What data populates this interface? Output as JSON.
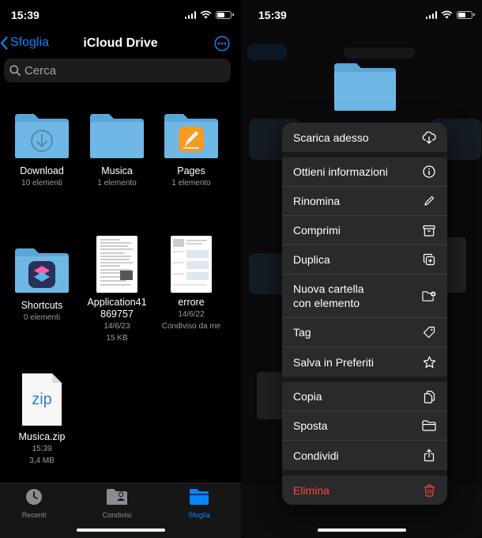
{
  "status": {
    "time": "15:39"
  },
  "nav": {
    "back_label": "Sfoglia",
    "title": "iCloud Drive"
  },
  "search": {
    "placeholder": "Cerca"
  },
  "files": [
    {
      "name": "Download",
      "meta1": "10 elementi",
      "meta2": ""
    },
    {
      "name": "Musica",
      "meta1": "1 elemento",
      "meta2": ""
    },
    {
      "name": "Pages",
      "meta1": "1 elemento",
      "meta2": ""
    },
    {
      "name": "Shortcuts",
      "meta1": "0 elementi",
      "meta2": ""
    },
    {
      "name": "Application41\n869757",
      "meta1": "14/6/23",
      "meta2": "15 KB"
    },
    {
      "name": "errore",
      "meta1": "14/6/22",
      "meta2": "Condiviso da me"
    },
    {
      "name": "Musica.zip",
      "meta1": "15:39",
      "meta2": "3,4 MB",
      "badge": "zip"
    }
  ],
  "tabs": [
    {
      "label": "Recenti",
      "icon": "clock-icon"
    },
    {
      "label": "Condivisi",
      "icon": "shared-folder-icon"
    },
    {
      "label": "Sfoglia",
      "icon": "browse-folder-icon",
      "active": true
    }
  ],
  "context_menu": {
    "items": [
      {
        "label": "Scarica adesso",
        "icon": "cloud-download-icon"
      },
      {
        "label": "Ottieni informazioni",
        "icon": "info-icon"
      },
      {
        "label": "Rinomina",
        "icon": "pencil-icon"
      },
      {
        "label": "Comprimi",
        "icon": "archive-box-icon"
      },
      {
        "label": "Duplica",
        "icon": "duplicate-icon"
      },
      {
        "label": "Nuova cartella\ncon elemento",
        "icon": "folder-plus-icon"
      },
      {
        "label": "Tag",
        "icon": "tag-icon"
      },
      {
        "label": "Salva in Preferiti",
        "icon": "star-icon"
      },
      {
        "label": "Copia",
        "icon": "copy-icon"
      },
      {
        "label": "Sposta",
        "icon": "folder-icon"
      },
      {
        "label": "Condividi",
        "icon": "share-icon"
      },
      {
        "label": "Elimina",
        "icon": "trash-icon"
      }
    ]
  },
  "colors": {
    "accent": "#0a84ff",
    "folder": "#6fb8e6",
    "danger": "#ff453a",
    "pages_orange": "#f59a23"
  }
}
